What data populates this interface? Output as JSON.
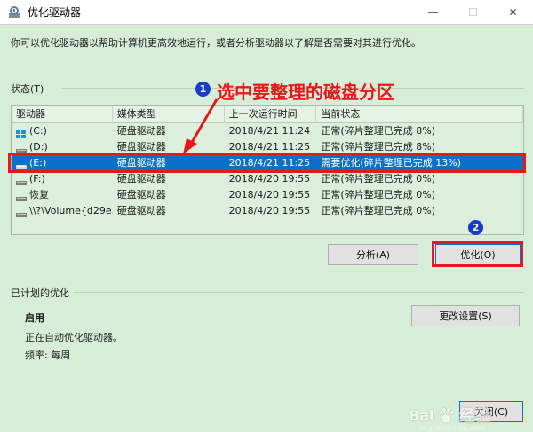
{
  "window": {
    "title": "优化驱动器",
    "minimize_glyph": "—",
    "maximize_glyph": "☐",
    "close_glyph": "✕"
  },
  "description": "你可以优化驱动器以帮助计算机更高效地运行，或者分析驱动器以了解是否需要对其进行优化。",
  "status_section": {
    "label": "状态(T)",
    "columns": [
      "驱动器",
      "媒体类型",
      "上一次运行时间",
      "当前状态"
    ],
    "rows": [
      {
        "drive": "(C:)",
        "icon": "windows-drive-icon",
        "media": "硬盘驱动器",
        "last_run": "2018/4/21 11:24",
        "status": "正常(碎片整理已完成 8%)"
      },
      {
        "drive": "(D:)",
        "icon": "drive-icon",
        "media": "硬盘驱动器",
        "last_run": "2018/4/21 11:25",
        "status": "正常(碎片整理已完成 8%)"
      },
      {
        "drive": "(E:)",
        "icon": "drive-icon",
        "media": "硬盘驱动器",
        "last_run": "2018/4/21 11:25",
        "status": "需要优化(碎片整理已完成 13%)"
      },
      {
        "drive": "(F:)",
        "icon": "drive-icon",
        "media": "硬盘驱动器",
        "last_run": "2018/4/20 19:55",
        "status": "正常(碎片整理已完成 0%)"
      },
      {
        "drive": "恢复",
        "icon": "drive-icon",
        "media": "硬盘驱动器",
        "last_run": "2018/4/20 19:55",
        "status": "正常(碎片整理已完成 0%)"
      },
      {
        "drive": "\\\\?\\Volume{d29e...",
        "icon": "drive-icon",
        "media": "硬盘驱动器",
        "last_run": "2018/4/20 19:55",
        "status": "正常(碎片整理已完成 0%)"
      }
    ],
    "selected_index": 2
  },
  "buttons": {
    "analyze": "分析(A)",
    "optimize": "优化(O)",
    "change_settings": "更改设置(S)",
    "close": "关闭(C)"
  },
  "schedule_section": {
    "label": "已计划的优化",
    "state": "启用",
    "detail": "正在自动优化驱动器。",
    "frequency": "频率: 每周"
  },
  "annotations": {
    "step1_badge": "1",
    "step1_text": "选中要整理的磁盘分区",
    "step2_badge": "2"
  },
  "watermark": {
    "brand": "Bai",
    "brand_suffix": "经验",
    "url": "jingyan.baidu.com"
  },
  "colors": {
    "background": "#d6eed8",
    "selection": "#0a71c8",
    "annotation_red": "#e8171b",
    "badge_blue": "#1a3bc4"
  }
}
